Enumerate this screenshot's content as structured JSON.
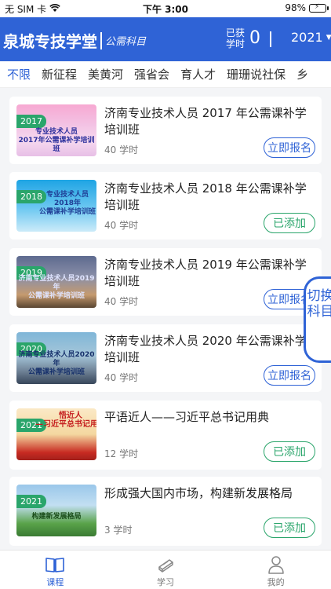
{
  "status_bar": {
    "carrier": "无 SIM 卡",
    "time": "下午 3:00",
    "battery": "98%"
  },
  "header": {
    "brand": "泉城专技学堂",
    "subtitle": "公需科目",
    "earned_label": "已获学时",
    "earned_value": "0",
    "year": "2021"
  },
  "tabs": [
    "不限",
    "新征程",
    "美黄河",
    "强省会",
    "育人才",
    "珊珊说社保",
    "乡"
  ],
  "courses": [
    {
      "year_badge": "2017",
      "thumb_caption": "专业技术人员\n2017年公需课补学培训班",
      "title": "济南专业技术人员 2017 年公需课补学培训班",
      "hours": "40 学时",
      "action": "立即报名",
      "status": "signup"
    },
    {
      "year_badge": "2018",
      "thumb_caption": "专业技术人员\n2018年\n公需课补学培训班",
      "title": "济南专业技术人员 2018 年公需课补学培训班",
      "hours": "40 学时",
      "action": "已添加",
      "status": "added"
    },
    {
      "year_badge": "2019",
      "thumb_caption": "济南专业技术人员2019年\n公需课补学培训班",
      "title": "济南专业技术人员 2019 年公需课补学培训班",
      "hours": "40 学时",
      "action": "立即报名",
      "status": "signup"
    },
    {
      "year_badge": "2020",
      "thumb_caption": "济南专业技术人员2020年\n公需课补学培训班",
      "title": "济南专业技术人员 2020 年公需课补学培训班",
      "hours": "40 学时",
      "action": "立即报名",
      "status": "signup"
    },
    {
      "year_badge": "2021",
      "thumb_caption": "悟近人\n—习近平总书记用典",
      "title": "平语近人——习近平总书记用典",
      "hours": "12 学时",
      "action": "已添加",
      "status": "added"
    },
    {
      "year_badge": "2021",
      "thumb_caption": "构建新发展格局",
      "title": "形成强大国内市场，构建新发展格局",
      "hours": "3 学时",
      "action": "已添加",
      "status": "added"
    }
  ],
  "switch_subject": "切换科目",
  "bottom_nav": [
    {
      "label": "课程",
      "icon": "book-icon",
      "active": true
    },
    {
      "label": "学习",
      "icon": "books-stack-icon",
      "active": false
    },
    {
      "label": "我的",
      "icon": "user-icon",
      "active": false
    }
  ],
  "colors": {
    "primary": "#2f63d6",
    "added_green": "#2aa56b",
    "badge_green": "#2aa56b"
  }
}
